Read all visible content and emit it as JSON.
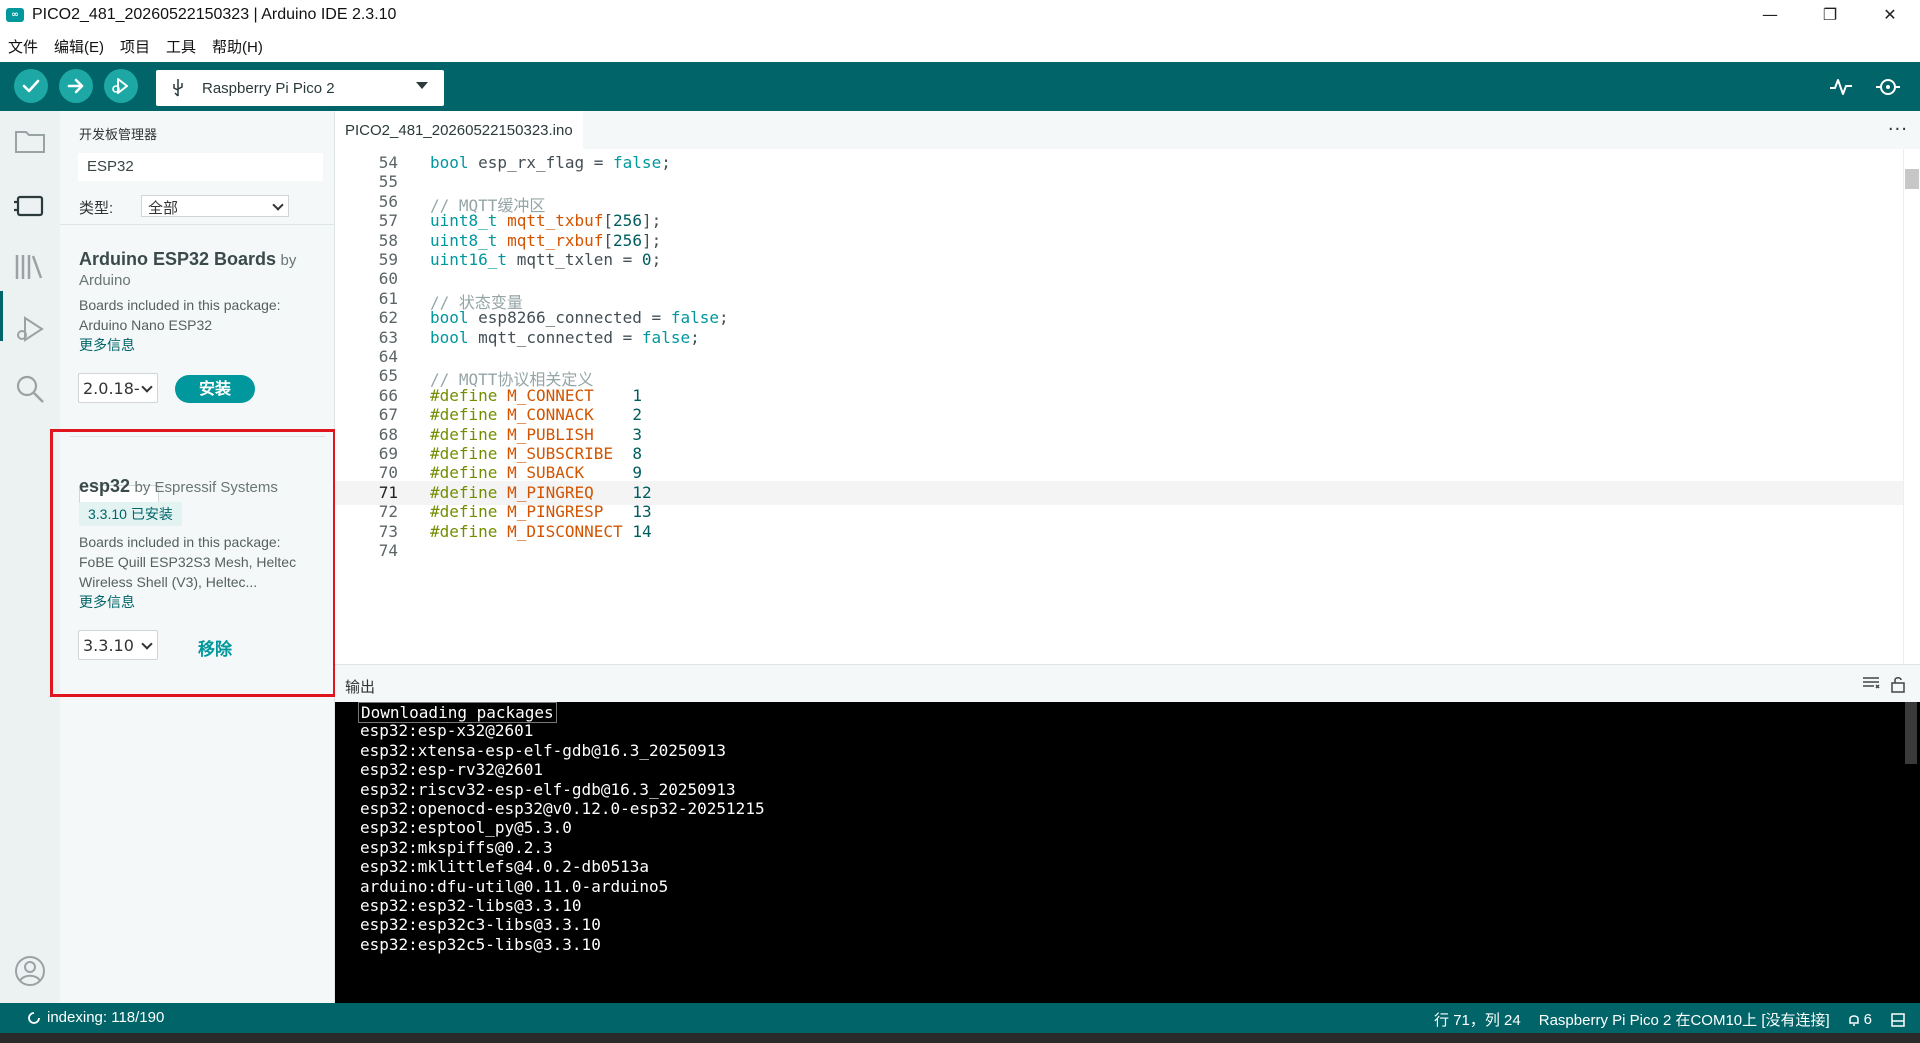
{
  "window": {
    "title": "PICO2_481_20260522150323 | Arduino IDE 2.3.10",
    "minimize": "—",
    "maximize": "❐",
    "close": "✕"
  },
  "menu": [
    "文件",
    "编辑(E)",
    "项目",
    "工具",
    "帮助(H)"
  ],
  "toolbar": {
    "board": "Raspberry Pi Pico 2",
    "accent": "#006468",
    "button_color": "#1da8a5"
  },
  "boards_manager": {
    "title": "开发板管理器",
    "search_value": "ESP32",
    "type_label": "类型:",
    "type_value": "全部",
    "packages": [
      {
        "name": "Arduino ESP32 Boards",
        "by": "by",
        "author": "Arduino",
        "desc": "Boards included in this package: Arduino Nano ESP32",
        "more": "更多信息",
        "version": "2.0.18-",
        "action": "安装"
      },
      {
        "name": "esp32",
        "by": "by Espressif Systems",
        "installed": "3.3.10 已安装",
        "desc": "Boards included in this package: FoBE Quill ESP32S3 Mesh, Heltec Wireless Shell (V3), Heltec...",
        "more": "更多信息",
        "version": "3.3.10",
        "action": "移除"
      }
    ]
  },
  "editor": {
    "tab": "PICO2_481_20260522150323.ino",
    "more": "···",
    "current_line": 71,
    "lines": [
      {
        "n": 54,
        "parts": [
          [
            "kw",
            "bool"
          ],
          [
            "t",
            " esp_rx_flag = "
          ],
          [
            "kw",
            "false"
          ],
          [
            "t",
            ";"
          ]
        ]
      },
      {
        "n": 55,
        "parts": []
      },
      {
        "n": 56,
        "parts": [
          [
            "cm",
            "// MQTT缓冲区"
          ]
        ]
      },
      {
        "n": 57,
        "parts": [
          [
            "kw",
            "uint8_t"
          ],
          [
            "t",
            " "
          ],
          [
            "var",
            "mqtt_txbuf"
          ],
          [
            "t",
            "["
          ],
          [
            "num",
            "256"
          ],
          [
            "t",
            "];"
          ]
        ]
      },
      {
        "n": 58,
        "parts": [
          [
            "kw",
            "uint8_t"
          ],
          [
            "t",
            " "
          ],
          [
            "var",
            "mqtt_rxbuf"
          ],
          [
            "t",
            "["
          ],
          [
            "num",
            "256"
          ],
          [
            "t",
            "];"
          ]
        ]
      },
      {
        "n": 59,
        "parts": [
          [
            "kw",
            "uint16_t"
          ],
          [
            "t",
            " mqtt_txlen = "
          ],
          [
            "num",
            "0"
          ],
          [
            "t",
            ";"
          ]
        ]
      },
      {
        "n": 60,
        "parts": []
      },
      {
        "n": 61,
        "parts": [
          [
            "cm",
            "// 状态变量"
          ]
        ]
      },
      {
        "n": 62,
        "parts": [
          [
            "kw",
            "bool"
          ],
          [
            "t",
            " esp8266_connected = "
          ],
          [
            "kw",
            "false"
          ],
          [
            "t",
            ";"
          ]
        ]
      },
      {
        "n": 63,
        "parts": [
          [
            "kw",
            "bool"
          ],
          [
            "t",
            " mqtt_connected = "
          ],
          [
            "kw",
            "false"
          ],
          [
            "t",
            ";"
          ]
        ]
      },
      {
        "n": 64,
        "parts": []
      },
      {
        "n": 65,
        "parts": [
          [
            "cm",
            "// MQTT协议相关定义"
          ]
        ]
      },
      {
        "n": 66,
        "parts": [
          [
            "pp",
            "#define"
          ],
          [
            "t",
            " "
          ],
          [
            "var",
            "M_CONNECT"
          ],
          [
            "t",
            "    "
          ],
          [
            "num",
            "1"
          ]
        ]
      },
      {
        "n": 67,
        "parts": [
          [
            "pp",
            "#define"
          ],
          [
            "t",
            " "
          ],
          [
            "var",
            "M_CONNACK"
          ],
          [
            "t",
            "    "
          ],
          [
            "num",
            "2"
          ]
        ]
      },
      {
        "n": 68,
        "parts": [
          [
            "pp",
            "#define"
          ],
          [
            "t",
            " "
          ],
          [
            "var",
            "M_PUBLISH"
          ],
          [
            "t",
            "    "
          ],
          [
            "num",
            "3"
          ]
        ]
      },
      {
        "n": 69,
        "parts": [
          [
            "pp",
            "#define"
          ],
          [
            "t",
            " "
          ],
          [
            "var",
            "M_SUBSCRIBE"
          ],
          [
            "t",
            "  "
          ],
          [
            "num",
            "8"
          ]
        ]
      },
      {
        "n": 70,
        "parts": [
          [
            "pp",
            "#define"
          ],
          [
            "t",
            " "
          ],
          [
            "var",
            "M_SUBACK"
          ],
          [
            "t",
            "     "
          ],
          [
            "num",
            "9"
          ]
        ]
      },
      {
        "n": 71,
        "parts": [
          [
            "pp",
            "#define"
          ],
          [
            "t",
            " "
          ],
          [
            "var",
            "M_PINGREQ"
          ],
          [
            "t",
            "    "
          ],
          [
            "num",
            "12"
          ]
        ]
      },
      {
        "n": 72,
        "parts": [
          [
            "pp",
            "#define"
          ],
          [
            "t",
            " "
          ],
          [
            "var",
            "M_PINGRESP"
          ],
          [
            "t",
            "   "
          ],
          [
            "num",
            "13"
          ]
        ]
      },
      {
        "n": 73,
        "parts": [
          [
            "pp",
            "#define"
          ],
          [
            "t",
            " "
          ],
          [
            "var",
            "M_DISCONNECT"
          ],
          [
            "t",
            " "
          ],
          [
            "num",
            "14"
          ]
        ]
      },
      {
        "n": 74,
        "parts": []
      }
    ]
  },
  "output": {
    "title": "输出",
    "lines": [
      "Downloading packages",
      "esp32:esp-x32@2601",
      "esp32:xtensa-esp-elf-gdb@16.3_20250913",
      "esp32:esp-rv32@2601",
      "esp32:riscv32-esp-elf-gdb@16.3_20250913",
      "esp32:openocd-esp32@v0.12.0-esp32-20251215",
      "esp32:esptool_py@5.3.0",
      "esp32:mkspiffs@0.2.3",
      "esp32:mklittlefs@4.0.2-db0513a",
      "arduino:dfu-util@0.11.0-arduino5",
      "esp32:esp32-libs@3.3.10",
      "esp32:esp32c3-libs@3.3.10",
      "esp32:esp32c5-libs@3.3.10"
    ]
  },
  "status": {
    "indexing": "indexing: 118/190",
    "position": "行 71，列 24",
    "board_port": "Raspberry Pi Pico 2 在COM10上 [没有连接]",
    "notifications": "6"
  }
}
